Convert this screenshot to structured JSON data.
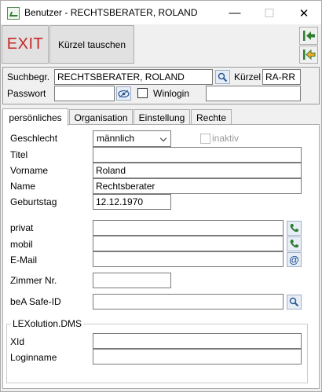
{
  "window": {
    "title": "Benutzer - RECHTSBERATER, ROLAND",
    "minimize_glyph": "—",
    "maximize_glyph": "☐",
    "close_glyph": "✕"
  },
  "toolbar": {
    "exit_label": "EXIT",
    "swap_label": "Kürzel tauschen",
    "exit_color": "#c62828",
    "nav_icon_color": "#2e7d32"
  },
  "search": {
    "label": "Suchbegr.",
    "value": "RECHTSBERATER, ROLAND",
    "kuerzel_label": "Kürzel",
    "kuerzel_value": "RA-RR",
    "password_label": "Passwort",
    "password_value": "",
    "winlogin_label": "Winlogin",
    "winlogin_value": ""
  },
  "tabs": [
    {
      "label": "persönliches",
      "active": true
    },
    {
      "label": "Organisation",
      "active": false
    },
    {
      "label": "Einstellung",
      "active": false
    },
    {
      "label": "Rechte",
      "active": false
    }
  ],
  "form": {
    "geschlecht_label": "Geschlecht",
    "geschlecht_value": "männlich",
    "inaktiv_label": "inaktiv",
    "titel_label": "Titel",
    "titel_value": "",
    "vorname_label": "Vorname",
    "vorname_value": "Roland",
    "name_label": "Name",
    "name_value": "Rechtsberater",
    "geburtstag_label": "Geburtstag",
    "geburtstag_value": "12.12.1970",
    "privat_label": "privat",
    "privat_value": "",
    "mobil_label": "mobil",
    "mobil_value": "",
    "email_label": "E-Mail",
    "email_value": "",
    "email_icon_glyph": "@",
    "zimmer_label": "Zimmer Nr.",
    "zimmer_value": "",
    "bea_label": "beA Safe-ID",
    "bea_value": ""
  },
  "dms": {
    "group_label": "LEXolution.DMS",
    "xid_label": "XId",
    "xid_value": "",
    "loginname_label": "Loginname",
    "loginname_value": ""
  }
}
